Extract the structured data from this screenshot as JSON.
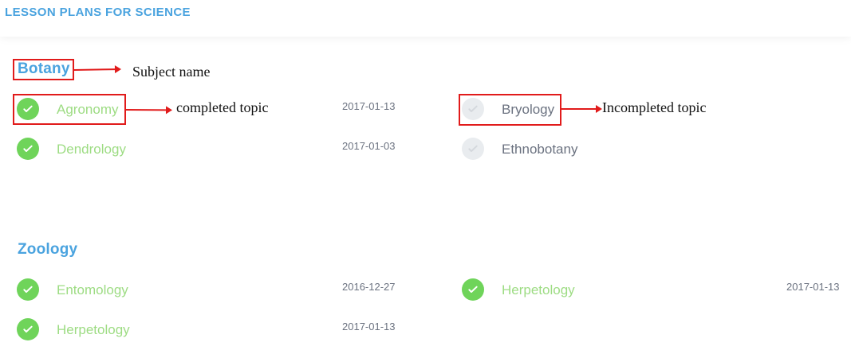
{
  "header": {
    "title": "LESSON PLANS FOR SCIENCE"
  },
  "subjects": [
    {
      "name": "Botany",
      "topics": [
        {
          "label": "Agronomy",
          "date": "2017-01-13",
          "completed": true
        },
        {
          "label": "Dendrology",
          "date": "2017-01-03",
          "completed": true
        },
        {
          "label": "Bryology",
          "date": "",
          "completed": false
        },
        {
          "label": "Ethnobotany",
          "date": "",
          "completed": false
        }
      ]
    },
    {
      "name": "Zoology",
      "topics": [
        {
          "label": "Entomology",
          "date": "2016-12-27",
          "completed": true
        },
        {
          "label": "Herpetology",
          "date": "2017-01-13",
          "completed": true
        },
        {
          "label": "Herpetology",
          "date": "2017-01-13",
          "completed": true
        }
      ]
    }
  ],
  "annotations": {
    "subject_name": "Subject name",
    "completed_topic": "completed topic",
    "incompleted_topic": "Incompleted topic"
  },
  "colors": {
    "accent": "#4aa3df",
    "complete": "#6fd45a",
    "complete_text": "#9ddc83",
    "incomplete": "#e9ecef",
    "annotation": "#e11b1b"
  },
  "icons": {
    "complete": "check-circle-icon",
    "incomplete": "check-circle-outline-icon"
  }
}
